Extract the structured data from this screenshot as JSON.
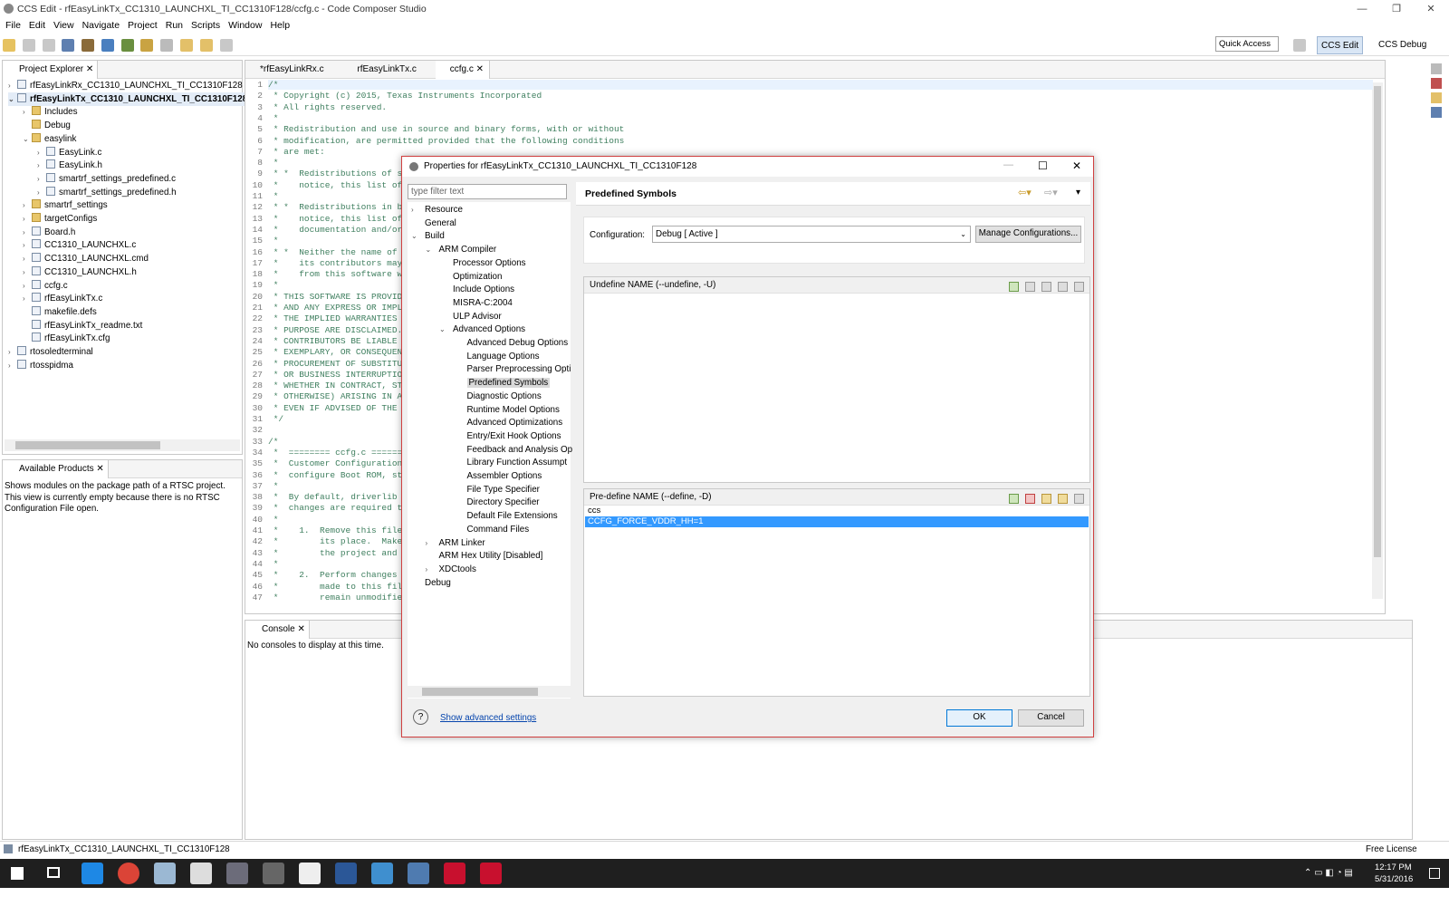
{
  "window": {
    "title": "CCS Edit - rfEasyLinkTx_CC1310_LAUNCHXL_TI_CC1310F128/ccfg.c - Code Composer Studio"
  },
  "menu": [
    "File",
    "Edit",
    "View",
    "Navigate",
    "Project",
    "Run",
    "Scripts",
    "Window",
    "Help"
  ],
  "toolbar": {
    "quick_access": "Quick Access",
    "persp_edit": "CCS Edit",
    "persp_debug": "CCS Debug"
  },
  "project_explorer": {
    "tab": "Project Explorer",
    "items": [
      {
        "label": "rfEasyLinkRx_CC1310_LAUNCHXL_TI_CC1310F128",
        "level": 0,
        "arrow": "›",
        "kind": "proj"
      },
      {
        "label": "rfEasyLinkTx_CC1310_LAUNCHXL_TI_CC1310F128",
        "level": 0,
        "arrow": "⌄",
        "kind": "proj",
        "bold": true
      },
      {
        "label": "Includes",
        "level": 1,
        "arrow": "›",
        "kind": "fold"
      },
      {
        "label": "Debug",
        "level": 1,
        "arrow": "",
        "kind": "fold"
      },
      {
        "label": "easylink",
        "level": 1,
        "arrow": "⌄",
        "kind": "fold"
      },
      {
        "label": "EasyLink.c",
        "level": 2,
        "arrow": "›",
        "kind": "file"
      },
      {
        "label": "EasyLink.h",
        "level": 2,
        "arrow": "›",
        "kind": "file"
      },
      {
        "label": "smartrf_settings_predefined.c",
        "level": 2,
        "arrow": "›",
        "kind": "file"
      },
      {
        "label": "smartrf_settings_predefined.h",
        "level": 2,
        "arrow": "›",
        "kind": "file"
      },
      {
        "label": "smartrf_settings",
        "level": 1,
        "arrow": "›",
        "kind": "fold"
      },
      {
        "label": "targetConfigs",
        "level": 1,
        "arrow": "›",
        "kind": "fold"
      },
      {
        "label": "Board.h",
        "level": 1,
        "arrow": "›",
        "kind": "file"
      },
      {
        "label": "CC1310_LAUNCHXL.c",
        "level": 1,
        "arrow": "›",
        "kind": "file"
      },
      {
        "label": "CC1310_LAUNCHXL.cmd",
        "level": 1,
        "arrow": "›",
        "kind": "file"
      },
      {
        "label": "CC1310_LAUNCHXL.h",
        "level": 1,
        "arrow": "›",
        "kind": "file"
      },
      {
        "label": "ccfg.c",
        "level": 1,
        "arrow": "›",
        "kind": "file"
      },
      {
        "label": "rfEasyLinkTx.c",
        "level": 1,
        "arrow": "›",
        "kind": "file"
      },
      {
        "label": "makefile.defs",
        "level": 1,
        "arrow": "",
        "kind": "file"
      },
      {
        "label": "rfEasyLinkTx_readme.txt",
        "level": 1,
        "arrow": "",
        "kind": "file"
      },
      {
        "label": "rfEasyLinkTx.cfg",
        "level": 1,
        "arrow": "",
        "kind": "file"
      },
      {
        "label": "rtosoledterminal",
        "level": 0,
        "arrow": "›",
        "kind": "proj"
      },
      {
        "label": "rtosspidma",
        "level": 0,
        "arrow": "›",
        "kind": "proj"
      }
    ]
  },
  "available_products": {
    "tab": "Available Products",
    "message": "Shows modules on the package path of a RTSC project. This view is currently empty because there is no RTSC Configuration File open."
  },
  "editor": {
    "tabs": [
      "*rfEasyLinkRx.c",
      "rfEasyLinkTx.c",
      "ccfg.c"
    ],
    "lines": [
      "/*",
      " * Copyright (c) 2015, Texas Instruments Incorporated",
      " * All rights reserved.",
      " *",
      " * Redistribution and use in source and binary forms, with or without",
      " * modification, are permitted provided that the following conditions",
      " * are met:",
      " *",
      " * *  Redistributions of so",
      " *    notice, this list of",
      " *",
      " * *  Redistributions in bi",
      " *    notice, this list of",
      " *    documentation and/or",
      " *",
      " * *  Neither the name of T",
      " *    its contributors may",
      " *    from this software wi",
      " *",
      " * THIS SOFTWARE IS PROVIDE",
      " * AND ANY EXPRESS OR IMPLI",
      " * THE IMPLIED WARRANTIES O",
      " * PURPOSE ARE DISCLAIMED.",
      " * CONTRIBUTORS BE LIABLE F",
      " * EXEMPLARY, OR CONSEQUENT",
      " * PROCUREMENT OF SUBSTITUT",
      " * OR BUSINESS INTERRUPTION",
      " * WHETHER IN CONTRACT, STR",
      " * OTHERWISE) ARISING IN AN",
      " * EVEN IF ADVISED OF THE P",
      " */",
      "",
      "/*",
      " *  ======== ccfg.c =======",
      " *  Customer Configuration",
      " *  configure Boot ROM, sta",
      " *",
      " *  By default, driverlib s",
      " *  changes are required t",
      " *",
      " *    1.  Remove this file",
      " *        its place.  Make",
      " *        the project and w",
      " *",
      " *    2.  Perform changes t",
      " *        made to this fil",
      " *        remain unmodified"
    ]
  },
  "console": {
    "tab": "Console",
    "message": "No consoles to display at this time."
  },
  "dialog": {
    "title": "Properties for rfEasyLinkTx_CC1310_LAUNCHXL_TI_CC1310F128",
    "filter_placeholder": "type filter text",
    "tree": [
      {
        "label": "Resource",
        "indent": 0,
        "arrow": "›"
      },
      {
        "label": "General",
        "indent": 0,
        "arrow": ""
      },
      {
        "label": "Build",
        "indent": 0,
        "arrow": "⌄"
      },
      {
        "label": "ARM Compiler",
        "indent": 1,
        "arrow": "⌄"
      },
      {
        "label": "Processor Options",
        "indent": 2,
        "arrow": ""
      },
      {
        "label": "Optimization",
        "indent": 2,
        "arrow": ""
      },
      {
        "label": "Include Options",
        "indent": 2,
        "arrow": ""
      },
      {
        "label": "MISRA-C:2004",
        "indent": 2,
        "arrow": ""
      },
      {
        "label": "ULP Advisor",
        "indent": 2,
        "arrow": ""
      },
      {
        "label": "Advanced Options",
        "indent": 2,
        "arrow": "⌄"
      },
      {
        "label": "Advanced Debug Options",
        "indent": 3,
        "arrow": ""
      },
      {
        "label": "Language Options",
        "indent": 3,
        "arrow": ""
      },
      {
        "label": "Parser Preprocessing Opti",
        "indent": 3,
        "arrow": ""
      },
      {
        "label": "Predefined Symbols",
        "indent": 3,
        "arrow": "",
        "selected": true
      },
      {
        "label": "Diagnostic Options",
        "indent": 3,
        "arrow": ""
      },
      {
        "label": "Runtime Model Options",
        "indent": 3,
        "arrow": ""
      },
      {
        "label": "Advanced Optimizations",
        "indent": 3,
        "arrow": ""
      },
      {
        "label": "Entry/Exit Hook Options",
        "indent": 3,
        "arrow": ""
      },
      {
        "label": "Feedback and Analysis Op",
        "indent": 3,
        "arrow": ""
      },
      {
        "label": "Library Function Assumpt",
        "indent": 3,
        "arrow": ""
      },
      {
        "label": "Assembler Options",
        "indent": 3,
        "arrow": ""
      },
      {
        "label": "File Type Specifier",
        "indent": 3,
        "arrow": ""
      },
      {
        "label": "Directory Specifier",
        "indent": 3,
        "arrow": ""
      },
      {
        "label": "Default File Extensions",
        "indent": 3,
        "arrow": ""
      },
      {
        "label": "Command Files",
        "indent": 3,
        "arrow": ""
      },
      {
        "label": "ARM Linker",
        "indent": 1,
        "arrow": "›"
      },
      {
        "label": "ARM Hex Utility  [Disabled]",
        "indent": 1,
        "arrow": ""
      },
      {
        "label": "XDCtools",
        "indent": 1,
        "arrow": "›"
      },
      {
        "label": "Debug",
        "indent": 0,
        "arrow": ""
      }
    ],
    "page_title": "Predefined Symbols",
    "config_label": "Configuration:",
    "config_value": "Debug  [ Active ]",
    "manage_btn": "Manage Configurations...",
    "undefine_title": "Undefine NAME (--undefine, -U)",
    "predefine_title": "Pre-define NAME (--define, -D)",
    "predefine_items": [
      {
        "value": "ccs",
        "selected": false
      },
      {
        "value": "CCFG_FORCE_VDDR_HH=1",
        "selected": true
      }
    ],
    "advanced_link": "Show advanced settings",
    "ok": "OK",
    "cancel": "Cancel"
  },
  "status": {
    "left": "rfEasyLinkTx_CC1310_LAUNCHXL_TI_CC1310F128",
    "right": "Free License"
  },
  "clock": {
    "time": "12:17 PM",
    "date": "5/31/2016"
  }
}
